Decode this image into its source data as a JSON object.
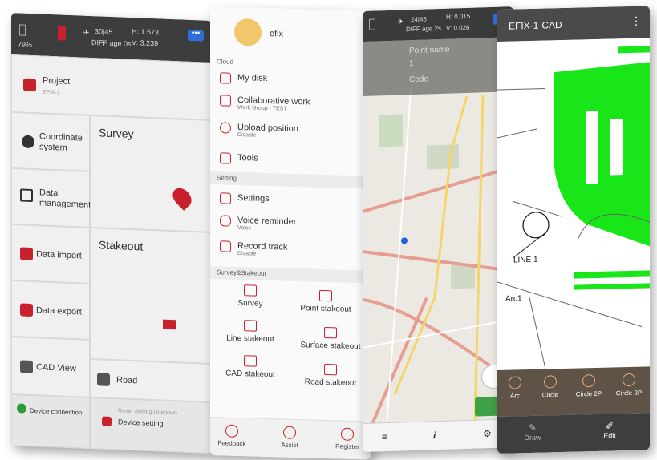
{
  "screen_main": {
    "status": {
      "battery": "79%",
      "sats": "30|45",
      "age": "DIFF age 0s",
      "h": "H: 1.573",
      "v": "V: 3.239",
      "more": "•••"
    },
    "project": {
      "label": "Project",
      "sub": "EFIX-1"
    },
    "tiles": [
      "Coordinate system",
      "Data management",
      "Data import",
      "Data export",
      "CAD View",
      "Road"
    ],
    "survey": "Survey",
    "stakeout": "Stakeout",
    "device_connection": "Device connection",
    "device_setting": {
      "label": "Device setting",
      "sub": "Rover Setting-Unknown"
    }
  },
  "screen_drawer": {
    "user": "efix",
    "cloud_header": "Cloud",
    "cloud_items": [
      {
        "label": "My disk",
        "sub": ""
      },
      {
        "label": "Collaborative work",
        "sub": "Work Group - TEST"
      },
      {
        "label": "Upload position",
        "sub": "Disable"
      },
      {
        "label": "Tools",
        "sub": ""
      }
    ],
    "setting_header": "Setting",
    "setting_items": [
      {
        "label": "Settings",
        "sub": ""
      },
      {
        "label": "Voice reminder",
        "sub": "Voice"
      },
      {
        "label": "Record track",
        "sub": "Disable"
      }
    ],
    "survey_header": "Survey&Stakeout",
    "grid": [
      "Survey",
      "Point stakeout",
      "Line stakeout",
      "Surface stakeout",
      "CAD stakeout",
      "Road stakeout"
    ],
    "footer": [
      "Feedback",
      "Assist",
      "Register"
    ]
  },
  "screen_map": {
    "status": {
      "sats": "24|45",
      "age": "DIFF age 2s",
      "h": "H: 0.015",
      "v": "V: 0.026",
      "more": "•••"
    },
    "point_name_label": "Point name",
    "point_name_value": "1",
    "code_label": "Code",
    "bar": [
      "≡",
      "i",
      "⚙"
    ]
  },
  "screen_cad": {
    "title": "EFIX-1-CAD",
    "labels": [
      "LINE 1",
      "Arc1"
    ],
    "tools": [
      "Arc",
      "Circle",
      "Circle 2P",
      "Circle 3P"
    ],
    "footer": [
      "Draw",
      "Edit"
    ]
  },
  "colors": {
    "accent_red": "#c8202d",
    "cad_green": "#19e619",
    "map_road": "#e9a3a3"
  }
}
